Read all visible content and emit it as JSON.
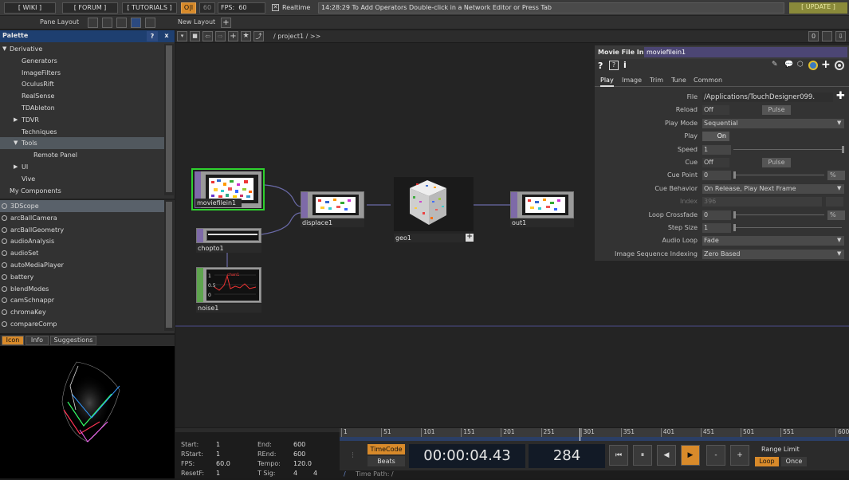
{
  "topbar": {
    "wiki": "[ WIKI ]",
    "forum": "[ FORUM ]",
    "tutorials": "[ TUTORIALS ]",
    "oi": "O|I",
    "fps_target": "60",
    "fps_label": "FPS:",
    "fps_value": "60",
    "realtime_label": "Realtime",
    "message": "14:28:29 To Add Operators Double-click in a Network Editor or Press Tab",
    "update": "[ UPDATE ]"
  },
  "bar2": {
    "pane_layout": "Pane Layout",
    "new_layout": "New Layout",
    "plus": "+"
  },
  "palette": {
    "title": "Palette",
    "help": "?",
    "close": "x",
    "tree": [
      {
        "label": "Derivative",
        "indent": 0,
        "arrow": "down"
      },
      {
        "label": "Generators",
        "indent": 1
      },
      {
        "label": "ImageFilters",
        "indent": 1
      },
      {
        "label": "OculusRift",
        "indent": 1
      },
      {
        "label": "RealSense",
        "indent": 1
      },
      {
        "label": "TDAbleton",
        "indent": 1
      },
      {
        "label": "TDVR",
        "indent": 1,
        "arrow": "right"
      },
      {
        "label": "Techniques",
        "indent": 1
      },
      {
        "label": "Tools",
        "indent": 1,
        "arrow": "down",
        "selected": true
      },
      {
        "label": "Remote Panel",
        "indent": 2
      },
      {
        "label": "UI",
        "indent": 1,
        "arrow": "right"
      },
      {
        "label": "Vive",
        "indent": 1
      },
      {
        "label": "My Components",
        "indent": 0
      }
    ],
    "components": [
      "3DScope",
      "arcBallCamera",
      "arcBallGeometry",
      "audioAnalysis",
      "audioSet",
      "autoMediaPlayer",
      "battery",
      "blendModes",
      "camSchnappr",
      "chromaKey",
      "compareComp"
    ],
    "tabs": [
      "Icon",
      "Info",
      "Suggestions"
    ]
  },
  "network": {
    "path": "/ project1 / >>",
    "zero": "0",
    "nodes": {
      "moviefilein1": "moviefilein1",
      "chopto1": "chopto1",
      "noise1": "noise1",
      "displace1": "displace1",
      "geo1": "geo1",
      "out1": "out1"
    },
    "noise_labels": {
      "top": "1",
      "mid": "0.5",
      "bottom": "0",
      "chan": "chan1"
    }
  },
  "param": {
    "op_type": "Movie File In",
    "op_name": "moviefilein1",
    "tabs": [
      "Play",
      "Image",
      "Trim",
      "Tune",
      "Common"
    ],
    "rows": [
      {
        "label": "File",
        "value": "/Applications/TouchDesigner099."
      },
      {
        "label": "Reload",
        "value": "Off",
        "button": "Pulse"
      },
      {
        "label": "Play Mode",
        "value": "Sequential"
      },
      {
        "label": "Play",
        "value": "On"
      },
      {
        "label": "Speed",
        "value": "1"
      },
      {
        "label": "Cue",
        "value": "Off",
        "button": "Pulse"
      },
      {
        "label": "Cue Point",
        "value": "0",
        "unit": "%"
      },
      {
        "label": "Cue Behavior",
        "value": "On Release, Play Next Frame"
      },
      {
        "label": "Index",
        "value": "396"
      },
      {
        "label": "Loop Crossfade",
        "value": "0",
        "unit": "%"
      },
      {
        "label": "Step Size",
        "value": "1"
      },
      {
        "label": "Audio Loop",
        "value": "Fade"
      },
      {
        "label": "Image Sequence Indexing",
        "value": "Zero Based"
      }
    ]
  },
  "timeinfo": {
    "start_lbl": "Start:",
    "start": "1",
    "rstart_lbl": "RStart:",
    "rstart": "1",
    "fps_lbl": "FPS:",
    "fps": "60.0",
    "resetf_lbl": "ResetF:",
    "resetf": "1",
    "end_lbl": "End:",
    "end": "600",
    "rend_lbl": "REnd:",
    "rend": "600",
    "tempo_lbl": "Tempo:",
    "tempo": "120.0",
    "tsig_lbl": "T Sig:",
    "tsig_a": "4",
    "tsig_b": "4"
  },
  "timeline": {
    "ticks": [
      "1",
      "51",
      "101",
      "151",
      "201",
      "251",
      "301",
      "351",
      "401",
      "451",
      "501",
      "551",
      "600"
    ],
    "timecode": "TimeCode",
    "beats": "Beats",
    "time": "00:00:04.43",
    "frame": "284",
    "range_limit": "Range Limit",
    "loop": "Loop",
    "once": "Once",
    "time_path": "Time Path: /",
    "minus": "-",
    "plus": "+"
  }
}
